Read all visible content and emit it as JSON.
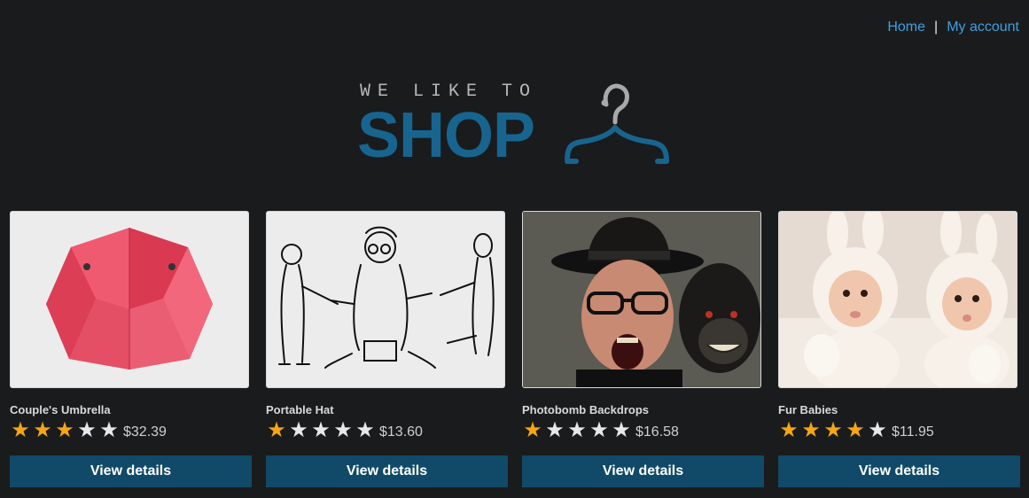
{
  "nav": {
    "home": "Home",
    "separator": "|",
    "account": "My account"
  },
  "logo": {
    "tagline": "WE LIKE TO",
    "word": "SHOP",
    "icon": "hanger-icon"
  },
  "colors": {
    "background": "#1a1b1d",
    "link": "#3fa0e0",
    "brand": "#17658f",
    "button": "#114a68",
    "star_on": "#f5a614",
    "star_off": "#e8e8e8"
  },
  "products": [
    {
      "name": "Couple's Umbrella",
      "rating": 3,
      "max_rating": 5,
      "price": "$32.39",
      "button": "View details",
      "image": "red-umbrella"
    },
    {
      "name": "Portable Hat",
      "rating": 1,
      "max_rating": 5,
      "price": "$13.60",
      "button": "View details",
      "image": "sketch-cartoon"
    },
    {
      "name": "Photobomb Backdrops",
      "rating": 1,
      "max_rating": 5,
      "price": "$16.58",
      "button": "View details",
      "image": "man-and-monkey"
    },
    {
      "name": "Fur Babies",
      "rating": 4,
      "max_rating": 5,
      "price": "$11.95",
      "button": "View details",
      "image": "babies-in-bunny-hats"
    }
  ]
}
